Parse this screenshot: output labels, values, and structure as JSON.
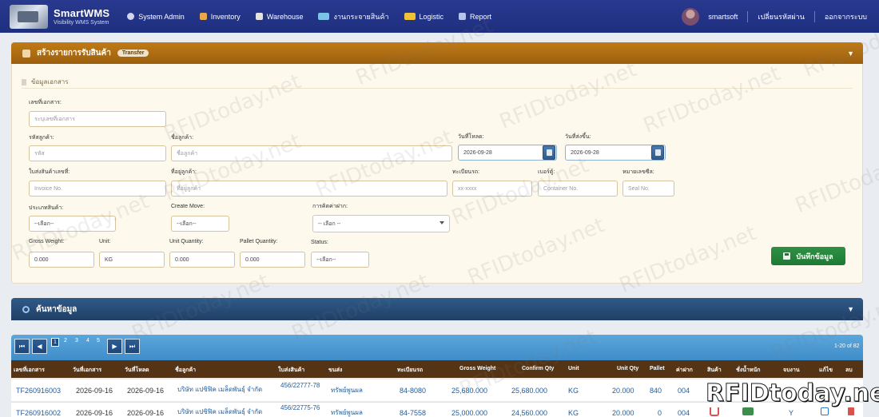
{
  "app": {
    "name": "SmartWMS",
    "tagline": "Visibility WMS System"
  },
  "menu": [
    {
      "label": "System Admin",
      "icon": "gear-icon",
      "color": "#cfd6ee"
    },
    {
      "label": "Inventory",
      "icon": "box-icon",
      "color": "#e8a74a"
    },
    {
      "label": "Warehouse",
      "icon": "warehouse-icon",
      "color": "#e3e3e3"
    },
    {
      "label": "งานกระจายสินค้า",
      "icon": "distribution-icon",
      "color": "#7cc3e8"
    },
    {
      "label": "Logistic",
      "icon": "truck-icon",
      "color": "#f0c23a"
    },
    {
      "label": "Report",
      "icon": "report-icon",
      "color": "#b8c4f0"
    }
  ],
  "user": {
    "name": "smartsoft",
    "change_password": "เปลี่ยนรหัสผ่าน",
    "logout": "ออกจากระบบ"
  },
  "form_panel": {
    "title": "สร้างรายการรับสินค้า",
    "tag": "Transfer",
    "section": "ข้อมูลเอกสาร"
  },
  "fields": {
    "doc_no": {
      "label": "เลขที่เอกสาร:",
      "placeholder": "ระบุเลขที่เอกสาร"
    },
    "customer_code": {
      "label": "รหัสลูกค้า:",
      "placeholder": "รหัส"
    },
    "customer_name": {
      "label": "ชื่อลูกค้า:",
      "placeholder": "ชื่อลูกค้า"
    },
    "unload_date": {
      "label": "วันที่โหลด:",
      "value": "2026-09-28"
    },
    "ship_date": {
      "label": "วันที่ส่งขึ้น:",
      "value": "2026-09-28"
    },
    "invoice": {
      "label": "ใบส่งสินค้าเลขที่:",
      "placeholder": "Invoice No."
    },
    "address": {
      "label": "ที่อยู่ลูกค้า:",
      "placeholder": "ที่อยู่ลูกค้า"
    },
    "plate": {
      "label": "ทะเบียนรถ:",
      "placeholder": "xx-xxxx"
    },
    "container": {
      "label": "เบอร์ตู้:",
      "placeholder": "Container No."
    },
    "seal": {
      "label": "หมายเลขซีล:",
      "placeholder": "Seal No."
    },
    "product_type": {
      "label": "ประเภทสินค้า:",
      "value": "--เลือก--"
    },
    "create_move": {
      "label": "Create Move:",
      "value": "--เลือก--"
    },
    "deposit_by": {
      "label": "การคิดค่าฝาก:",
      "value": "-- เลือก --"
    },
    "gross_weight": {
      "label": "Gross Weight:",
      "value": "0.000"
    },
    "unit": {
      "label": "Unit:",
      "value": "KG"
    },
    "unit_qty": {
      "label": "Unit Quantity:",
      "value": "0.000"
    },
    "pallet_qty": {
      "label": "Pallet Quantity:",
      "value": "0.000"
    },
    "status": {
      "label": "Status:",
      "value": "--เลือก--"
    }
  },
  "save_label": "บันทึกข้อมูล",
  "search_panel": {
    "title": "ค้นหาข้อมูล"
  },
  "pagination": {
    "pages": [
      "1",
      "2",
      "3",
      "4",
      "5"
    ],
    "info": "1-20 of 82"
  },
  "table": {
    "headers": [
      "เลขที่เอกสาร",
      "วันที่เอกสาร",
      "วันที่โหลด",
      "ชื่อลูกค้า",
      "ใบส่งสินค้า",
      "ขนส่ง",
      "ทะเบียนรถ",
      "Gross Weight",
      "Confirm Qty",
      "Unit",
      "Unit Qty",
      "Pallet",
      "ค่าฝาก",
      "สินค้า",
      "ชั่งน้ำหนัก",
      "จบงาน",
      "แก้ไข",
      "ลบ"
    ],
    "rows": [
      {
        "doc": "TF260916003",
        "doc_date": "2026-09-16",
        "load_date": "2026-09-16",
        "customer": "บริษัท แปซิฟิค เมล็ดพันธุ์ จำกัด",
        "invoice": "456/22777-78",
        "transport": "ทรัพย์พูนผล",
        "plate": "84-8080",
        "gross": "25,680.000",
        "confirm": "25,680.000",
        "unit": "KG",
        "unit_qty": "20.000",
        "pallet": "840",
        "deposit": "004",
        "done": "Y"
      },
      {
        "doc": "TF260916002",
        "doc_date": "2026-09-16",
        "load_date": "2026-09-16",
        "customer": "บริษัท แปซิฟิค เมล็ดพันธุ์ จำกัด",
        "invoice": "456/22775-76",
        "transport": "ทรัพย์พูนผล",
        "plate": "84-7558",
        "gross": "25,000.000",
        "confirm": "24,560.000",
        "unit": "KG",
        "unit_qty": "20.000",
        "pallet": "0",
        "deposit": "004",
        "done": "Y"
      }
    ]
  },
  "watermark": "RFIDtoday.net"
}
